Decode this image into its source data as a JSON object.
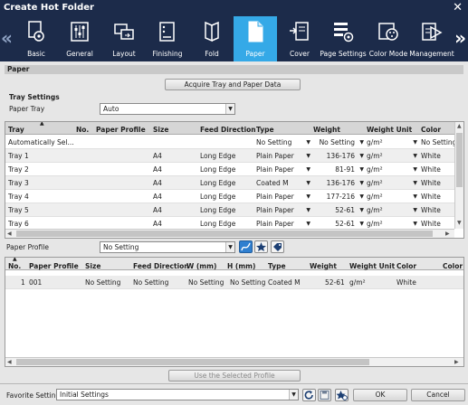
{
  "window": {
    "title": "Create Hot Folder"
  },
  "tabs": [
    {
      "label": "Basic",
      "icon": "basic-icon"
    },
    {
      "label": "General",
      "icon": "general-icon"
    },
    {
      "label": "Layout",
      "icon": "layout-icon"
    },
    {
      "label": "Finishing",
      "icon": "finishing-icon"
    },
    {
      "label": "Fold",
      "icon": "fold-icon"
    },
    {
      "label": "Paper",
      "icon": "paper-icon",
      "active": true
    },
    {
      "label": "Cover",
      "icon": "cover-icon"
    },
    {
      "label": "Page Settings",
      "icon": "page-settings-icon"
    },
    {
      "label": "Color Mode",
      "icon": "color-mode-icon"
    },
    {
      "label": "Management",
      "icon": "management-icon"
    }
  ],
  "colors": {
    "accent": "#35a9e7",
    "dark": "#1c2b4a"
  },
  "paper": {
    "section_title": "Paper",
    "acquire_button": "Acquire Tray and Paper Data",
    "tray_settings_label": "Tray Settings",
    "paper_tray_label": "Paper Tray",
    "paper_tray_value": "Auto",
    "tray_columns": [
      "Tray",
      "No.",
      "Paper Profile",
      "Size",
      "Feed Direction",
      "Type",
      "Weight",
      "Weight Unit",
      "Color"
    ],
    "tray_rows": [
      {
        "tray": "Automatically Sel...",
        "no": "",
        "profile": "",
        "size": "",
        "feed": "",
        "type": "No Setting",
        "weight": "No Setting",
        "unit": "g/m²",
        "color": "No Setting"
      },
      {
        "tray": "Tray 1",
        "no": "",
        "profile": "",
        "size": "A4",
        "feed": "Long Edge",
        "type": "Plain Paper",
        "weight": "136-176",
        "unit": "g/m²",
        "color": "White"
      },
      {
        "tray": "Tray 2",
        "no": "",
        "profile": "",
        "size": "A4",
        "feed": "Long Edge",
        "type": "Plain Paper",
        "weight": "81-91",
        "unit": "g/m²",
        "color": "White"
      },
      {
        "tray": "Tray 3",
        "no": "",
        "profile": "",
        "size": "A4",
        "feed": "Long Edge",
        "type": "Coated M",
        "weight": "136-176",
        "unit": "g/m²",
        "color": "White"
      },
      {
        "tray": "Tray 4",
        "no": "",
        "profile": "",
        "size": "A4",
        "feed": "Long Edge",
        "type": "Plain Paper",
        "weight": "177-216",
        "unit": "g/m²",
        "color": "White"
      },
      {
        "tray": "Tray 5",
        "no": "",
        "profile": "",
        "size": "A4",
        "feed": "Long Edge",
        "type": "Plain Paper",
        "weight": "52-61",
        "unit": "g/m²",
        "color": "White"
      },
      {
        "tray": "Tray 6",
        "no": "",
        "profile": "",
        "size": "A4",
        "feed": "Long Edge",
        "type": "Plain Paper",
        "weight": "52-61",
        "unit": "g/m²",
        "color": "White"
      }
    ],
    "paper_profile_label": "Paper Profile",
    "paper_profile_value": "No Setting",
    "profile_columns": [
      "No.",
      "Paper Profile",
      "Size",
      "Feed Direction",
      "W (mm)",
      "H (mm)",
      "Type",
      "Weight",
      "Weight Unit",
      "Color",
      "Color N"
    ],
    "profile_rows": [
      {
        "no": "1",
        "profile": "001",
        "size": "No Setting",
        "feed": "No Setting",
        "w": "No Setting",
        "h": "No Setting",
        "type": "Coated M",
        "weight": "52-61",
        "unit": "g/m²",
        "color": "White"
      }
    ],
    "use_profile_button": "Use the Selected Profile"
  },
  "footer": {
    "favorite_label": "Favorite Setting",
    "favorite_value": "Initial Settings",
    "ok": "OK",
    "cancel": "Cancel"
  }
}
